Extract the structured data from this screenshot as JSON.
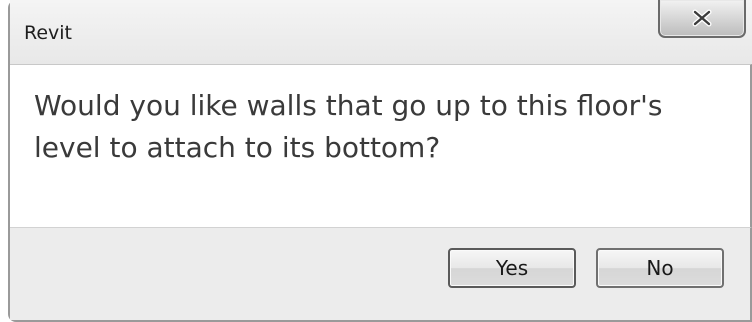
{
  "window": {
    "title": "Revit",
    "close_icon": "close-icon"
  },
  "message": "Would you like walls that go up to this floor's level to attach to its bottom?",
  "buttons": {
    "yes_label": "Yes",
    "no_label": "No"
  }
}
